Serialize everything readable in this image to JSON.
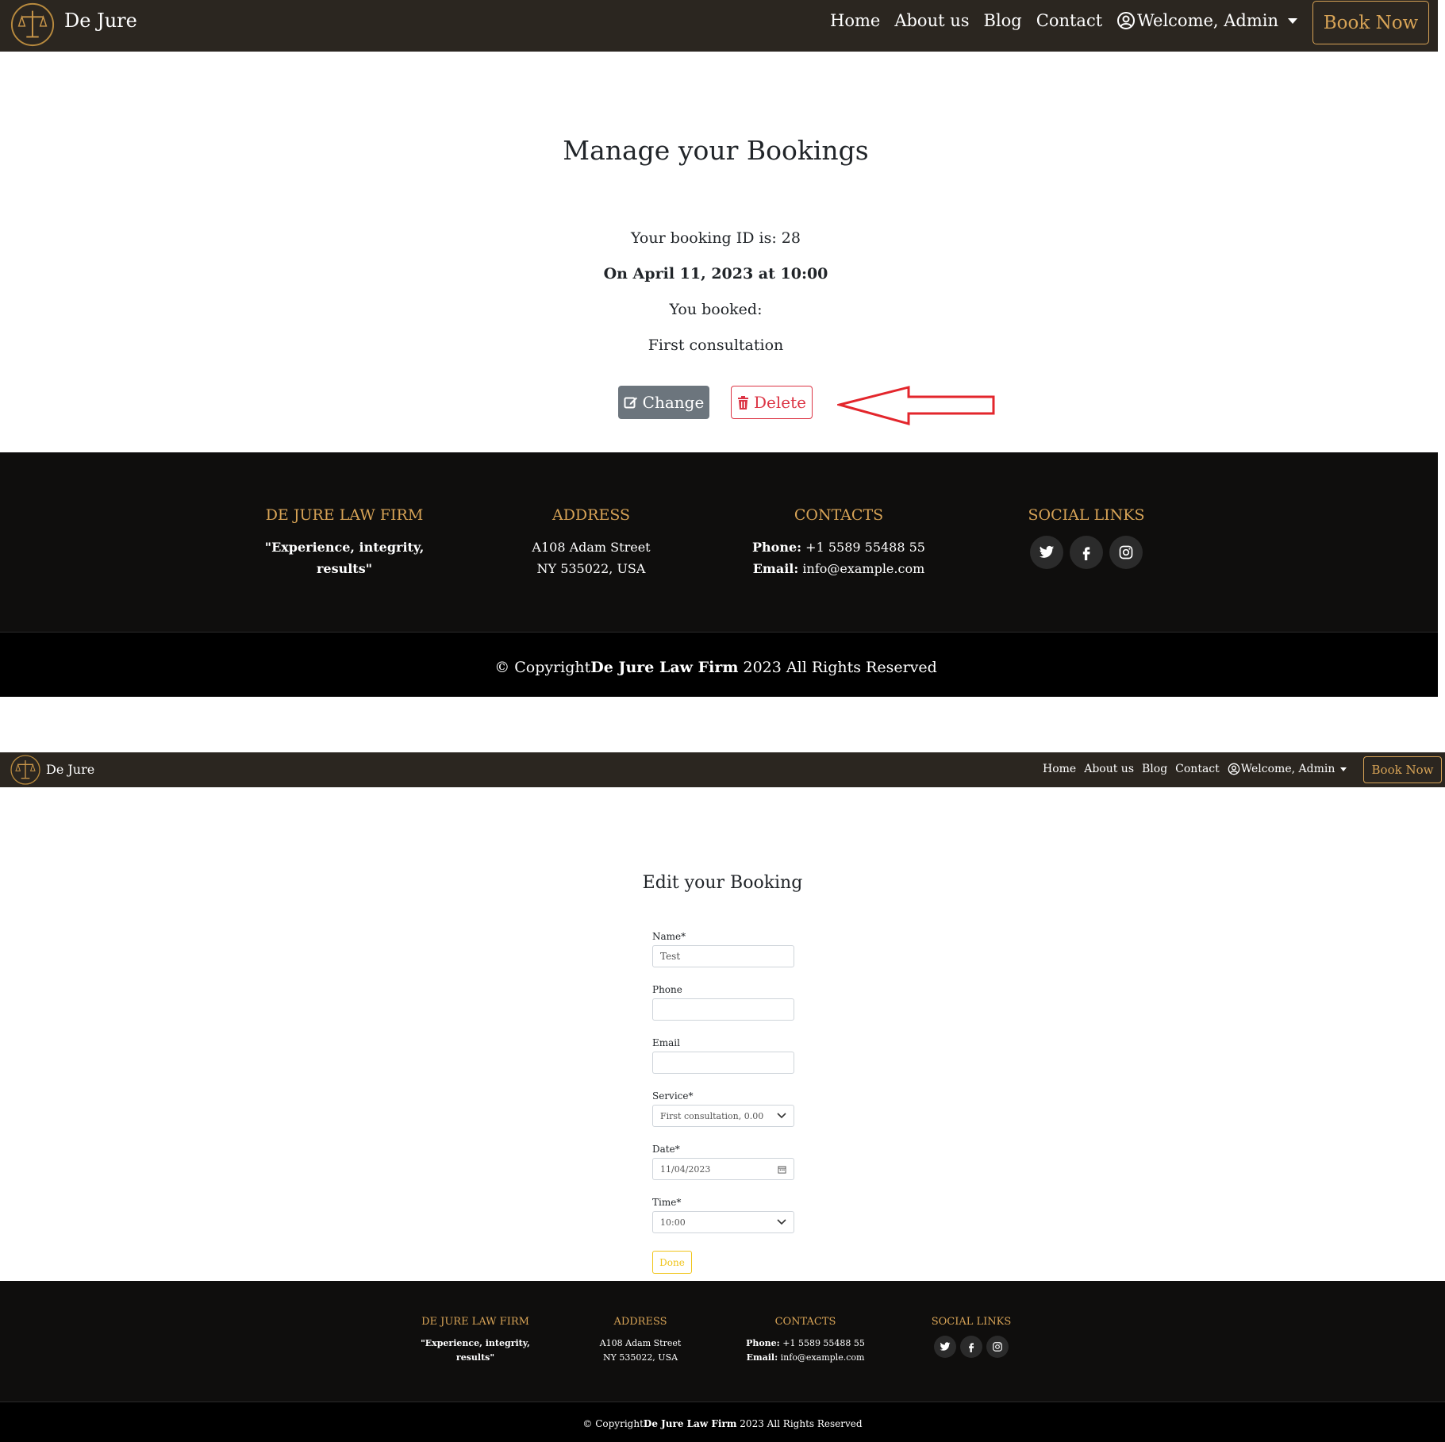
{
  "nav": {
    "brand": "De Jure",
    "links": [
      "Home",
      "About us",
      "Blog",
      "Contact"
    ],
    "user": "Welcome, Admin",
    "book_now": "Book Now"
  },
  "manage": {
    "title": "Manage your Bookings",
    "booking_id_text": "Your booking ID is: 28",
    "date_text": "On April 11, 2023 at 10:00",
    "booked_label": "You booked:",
    "service": "First consultation",
    "change_label": "Change",
    "delete_label": "Delete"
  },
  "footer": {
    "firm_heading": "DE JURE LAW FIRM",
    "tagline": "\"Experience, integrity, results\"",
    "address_heading": "ADDRESS",
    "address_line1": "A108 Adam Street",
    "address_line2": "NY 535022, USA",
    "contacts_heading": "CONTACTS",
    "phone_label": "Phone:",
    "phone": "+1 5589 55488 55",
    "email_label": "Email:",
    "email": "info@example.com",
    "social_heading": "SOCIAL LINKS",
    "social_icons": [
      "twitter-icon",
      "facebook-icon",
      "instagram-icon"
    ],
    "copyright_prefix": "© Copyright",
    "copyright_firm": "De Jure Law Firm",
    "copyright_suffix": " 2023 All Rights Reserved"
  },
  "edit": {
    "title": "Edit your Booking",
    "name_label": "Name*",
    "name_value": "Test",
    "phone_label": "Phone",
    "phone_value": "",
    "email_label": "Email",
    "email_value": "",
    "service_label": "Service*",
    "service_value": "First consultation, 0.00",
    "date_label": "Date*",
    "date_value": "11/04/2023",
    "time_label": "Time*",
    "time_value": "10:00",
    "done_label": "Done"
  },
  "colors": {
    "nav_bg": "#2b2620",
    "accent_gold": "#d7a356",
    "footer_bg": "#0f0e0d",
    "change_btn": "#6c757d",
    "delete_btn": "#dc3545",
    "done_btn": "#f0c419",
    "annotation_arrow": "#e3262c"
  }
}
